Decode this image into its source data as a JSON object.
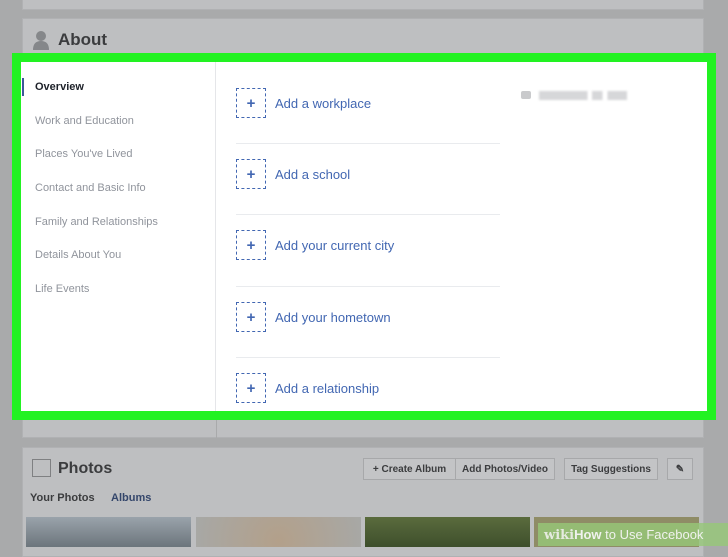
{
  "about": {
    "title": "About"
  },
  "nav": [
    "Overview",
    "Work and Education",
    "Places You've Lived",
    "Contact and Basic Info",
    "Family and Relationships",
    "Details About You",
    "Life Events"
  ],
  "add_items": [
    "Add a workplace",
    "Add a school",
    "Add your current city",
    "Add your hometown",
    "Add a relationship"
  ],
  "plus_symbol": "+",
  "photos": {
    "title": "Photos",
    "create_album": "+ Create Album",
    "add_photos": "Add Photos/Video",
    "tag_suggestions": "Tag Suggestions",
    "edit_symbol": "✎",
    "tabs": [
      "Your Photos",
      "Albums"
    ]
  },
  "watermark": {
    "wiki": "wiki",
    "how": "How",
    "rest": " to Use Facebook"
  },
  "colors": {
    "highlight": "#22f222",
    "link": "#4267b2"
  }
}
